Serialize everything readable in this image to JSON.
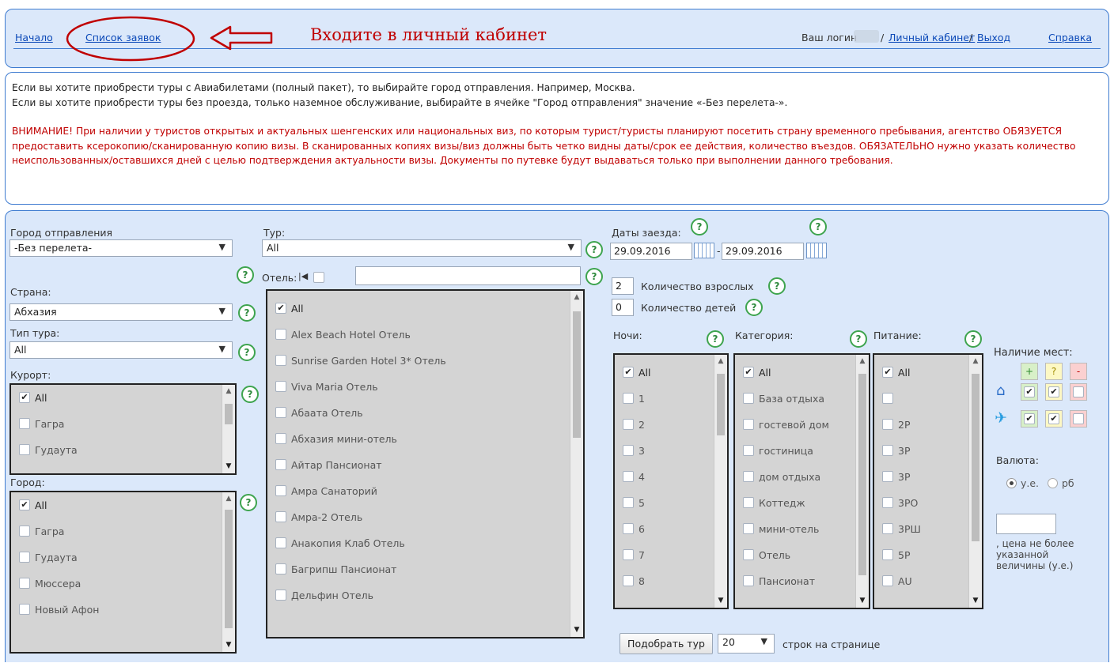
{
  "nav": {
    "home": "Начало",
    "orders": "Список заявок",
    "hint": "Входите в личный кабинет",
    "login_label": "Ваш логин",
    "cabinet": "Личный кабинет",
    "sep": "/",
    "logout": "Выход",
    "help": "Справка"
  },
  "notice": {
    "line1": "Если вы хотите приобрести туры с Авиабилетами (полный пакет), то выбирайте город отправления. Например, Москва.",
    "line2": "Если вы хотите приобрести туры без проезда, только наземное обслуживание, выбирайте в ячейке \"Город отправления\" значение «-Без перелета-».",
    "warning": "ВНИМАНИЕ! При наличии у туристов открытых и актуальных шенгенских или национальных виз, по которым турист/туристы планируют посетить страну временного пребывания, агентство ОБЯЗУЕТСЯ предоставить ксерокопию/сканированную копию визы. В сканированных копиях визы/виз должны быть четко видны даты/срок ее действия, количество въездов. ОБЯЗАТЕЛЬНО нужно указать количество неиспользованных/оставшихся дней с целью подтверждения актуальности визы. Документы по путевке будут выдаваться только при выполнении данного требования."
  },
  "form": {
    "departure_label": "Город отправления",
    "departure_value": "-Без перелета-",
    "country_label": "Страна:",
    "country_value": "Абхазия",
    "tour_type_label": "Тип тура:",
    "tour_type_value": "All",
    "resort_label": "Курорт:",
    "resorts": [
      {
        "label": "All",
        "checked": true
      },
      {
        "label": "Гагра",
        "checked": false
      },
      {
        "label": "Гудаута",
        "checked": false
      }
    ],
    "city_label": "Город:",
    "cities": [
      {
        "label": "All",
        "checked": true
      },
      {
        "label": "Гагра",
        "checked": false
      },
      {
        "label": "Гудаута",
        "checked": false
      },
      {
        "label": "Мюссера",
        "checked": false
      },
      {
        "label": "Новый Афон",
        "checked": false
      }
    ],
    "tour_label": "Тур:",
    "tour_value": "All",
    "hotel_label": "Отель:",
    "hotel_first": "|◀",
    "hotel_search_value": "",
    "hotels": [
      {
        "label": "All",
        "checked": true
      },
      {
        "label": "Alex Beach Hotel Отель",
        "checked": false
      },
      {
        "label": "Sunrise Garden Hotel 3* Отель",
        "checked": false
      },
      {
        "label": "Viva Maria Отель",
        "checked": false
      },
      {
        "label": "Абаата Отель",
        "checked": false
      },
      {
        "label": "Абхазия мини-отель",
        "checked": false
      },
      {
        "label": "Айтар Пансионат",
        "checked": false
      },
      {
        "label": "Амра Санаторий",
        "checked": false
      },
      {
        "label": "Амра-2 Отель",
        "checked": false
      },
      {
        "label": "Анакопия Клаб Отель",
        "checked": false
      },
      {
        "label": "Багрипш Пансионат",
        "checked": false
      },
      {
        "label": "Дельфин Отель",
        "checked": false
      }
    ],
    "dates_label": "Даты заезда:",
    "date_from": "29.09.2016",
    "date_dash": "-",
    "date_to": "29.09.2016",
    "adults_value": "2",
    "adults_label": "Количество взрослых",
    "children_value": "0",
    "children_label": "Количество детей",
    "nights_label": "Ночи:",
    "nights": [
      {
        "label": "All",
        "checked": true
      },
      {
        "label": "1",
        "checked": false
      },
      {
        "label": "2",
        "checked": false
      },
      {
        "label": "3",
        "checked": false
      },
      {
        "label": "4",
        "checked": false
      },
      {
        "label": "5",
        "checked": false
      },
      {
        "label": "6",
        "checked": false
      },
      {
        "label": "7",
        "checked": false
      },
      {
        "label": "8",
        "checked": false
      }
    ],
    "category_label": "Категория:",
    "categories": [
      {
        "label": "All",
        "checked": true
      },
      {
        "label": "База отдыха",
        "checked": false
      },
      {
        "label": "гостевой дом",
        "checked": false
      },
      {
        "label": "гостиница",
        "checked": false
      },
      {
        "label": "дом отдыха",
        "checked": false
      },
      {
        "label": "Коттедж",
        "checked": false
      },
      {
        "label": "мини-отель",
        "checked": false
      },
      {
        "label": "Отель",
        "checked": false
      },
      {
        "label": "Пансионат",
        "checked": false
      }
    ],
    "meal_label": "Питание:",
    "meals": [
      {
        "label": "All",
        "checked": true
      },
      {
        "label": "",
        "checked": false
      },
      {
        "label": "2Р",
        "checked": false
      },
      {
        "label": "3Р",
        "checked": false
      },
      {
        "label": "3Р",
        "checked": false
      },
      {
        "label": "3РО",
        "checked": false
      },
      {
        "label": "3РШ",
        "checked": false
      },
      {
        "label": "5Р",
        "checked": false
      },
      {
        "label": "AU",
        "checked": false
      }
    ],
    "availability_label": "Наличие мест:",
    "avail_plus": "+",
    "avail_q": "?",
    "avail_minus": "-",
    "currency_label": "Валюта:",
    "currency_ue": "у.е.",
    "currency_rub": "рб",
    "currency_selected": "у.е.",
    "price_value": "",
    "price_note": ", цена не более указанной величины (у.е.)",
    "search_button": "Подобрать тур",
    "rows_value": "20",
    "rows_label": "строк на странице",
    "help_glyph": "?"
  },
  "colors": {
    "accent_blue": "#3e7bd0",
    "panel_bg": "#dbe8fa",
    "warning_red": "#c00000",
    "help_green": "#3ea44e"
  }
}
